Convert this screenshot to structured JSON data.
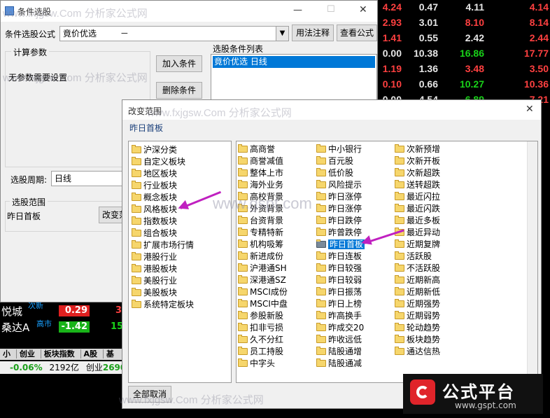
{
  "background_table": {
    "rows": [
      {
        "a": "4.24",
        "b": "0.47",
        "c": "4.11",
        "d": "4.14",
        "ca": "red",
        "cc": "white",
        "cd": "red"
      },
      {
        "a": "2.93",
        "b": "3.01",
        "c": "8.10",
        "d": "8.14",
        "ca": "red",
        "cc": "red",
        "cd": "red"
      },
      {
        "a": "1.41",
        "b": "0.55",
        "c": "2.42",
        "d": "2.44",
        "ca": "red",
        "cc": "white",
        "cd": "red"
      },
      {
        "a": "0.00",
        "b": "10.38",
        "c": "16.86",
        "d": "17.77",
        "ca": "white",
        "cc": "green",
        "cd": "red"
      },
      {
        "a": "1.19",
        "b": "1.36",
        "c": "3.48",
        "d": "3.50",
        "ca": "red",
        "cc": "red",
        "cd": "red"
      },
      {
        "a": "0.10",
        "b": "0.66",
        "c": "10.27",
        "d": "10.36",
        "ca": "red",
        "cc": "green",
        "cd": "red"
      },
      {
        "a": "0.00",
        "b": "4.54",
        "c": "6.89",
        "d": "7.21",
        "ca": "white",
        "cc": "green",
        "cd": "red"
      }
    ],
    "bottom_names": [
      "悦城",
      "桑达A"
    ],
    "bottom_values": [
      "0.29",
      "-1.42"
    ],
    "bottom_partial": [
      "3.",
      "15."
    ],
    "tag_yunjian": "次新",
    "tag_gaoshi": "高市",
    "tabs": [
      "小",
      "创业",
      "板块指数",
      "A股",
      "基"
    ],
    "status_pct": "-0.06%",
    "status_amount": "2192亿",
    "status_index_label": "创业",
    "status_index_value": "2690.83"
  },
  "main_window": {
    "title": "条件选股",
    "formula_label": "条件选股公式",
    "formula_value": "竟价优选",
    "formula_suffix": "－",
    "usage_btn": "用法注释",
    "view_formula_btn": "查看公式",
    "calc_params_title": "计算参数",
    "no_params_text": "无参数需要设置",
    "add_condition_btn": "加入条件",
    "delete_condition_btn": "删除条件",
    "condition_list_title": "选股条件列表",
    "condition_items": [
      "竟价优选 日线"
    ],
    "period_label": "选股周期:",
    "period_value": "日线",
    "range_title": "选股范围",
    "range_value": "昨日首板",
    "change_range_btn": "改变范"
  },
  "dialog": {
    "title": "改变范围",
    "current": "昨日首板",
    "tree_items": [
      "沪深分类",
      "自定义板块",
      "地区板块",
      "行业板块",
      "概念板块",
      "风格板块",
      "指数板块",
      "组合板块",
      "扩展市场行情",
      "港股行业",
      "港股板块",
      "美股行业",
      "美股板块",
      "系统特定板块"
    ],
    "col1": [
      "高商誉",
      "商誉减值",
      "整体上市",
      "海外业务",
      "高校背景",
      "外资背景",
      "台资背景",
      "专精特新",
      "机构吸筹",
      "新进成份",
      "沪港通SH",
      "深港通SZ",
      "MSCI成份",
      "MSCI中盘",
      "参股新股",
      "扣非亏损",
      "久不分红",
      "员工持股",
      "中字头"
    ],
    "col2": [
      "中小银行",
      "百元股",
      "低价股",
      "风险提示",
      "昨日涨停",
      "昨日涨停",
      "昨日跌停",
      "昨曾跌停",
      "昨日首板",
      "昨日连板",
      "昨日较强",
      "昨日较弱",
      "昨日振荡",
      "昨日上榜",
      "昨高换手",
      "昨成交20",
      "昨收远低",
      "陆股通增",
      "陆股通减"
    ],
    "col3": [
      "次新预增",
      "次新开板",
      "次新超跌",
      "送转超跌",
      "最近闪拉",
      "最近闪跌",
      "最近多板",
      "最近异动",
      "近期复牌",
      "活跃股",
      "不活跃股",
      "近期新高",
      "近期新低",
      "近期强势",
      "近期弱势",
      "轮动趋势",
      "板块趋势",
      "通达信热"
    ],
    "selected": "昨日首板",
    "cancel_all_btn": "全部取消"
  },
  "watermarks": [
    "www.fxjgsw.Com 分析家公式网",
    "www.gspt.com"
  ],
  "logo": {
    "text": "公式平台",
    "url": "www.gspt.com"
  },
  "window_controls": {
    "minimize": "—",
    "maximize": "☐",
    "close": "✕"
  },
  "colors": {
    "accent": "#0078d7",
    "arrow": "#c020c0",
    "logo_red": "#e0242a"
  }
}
